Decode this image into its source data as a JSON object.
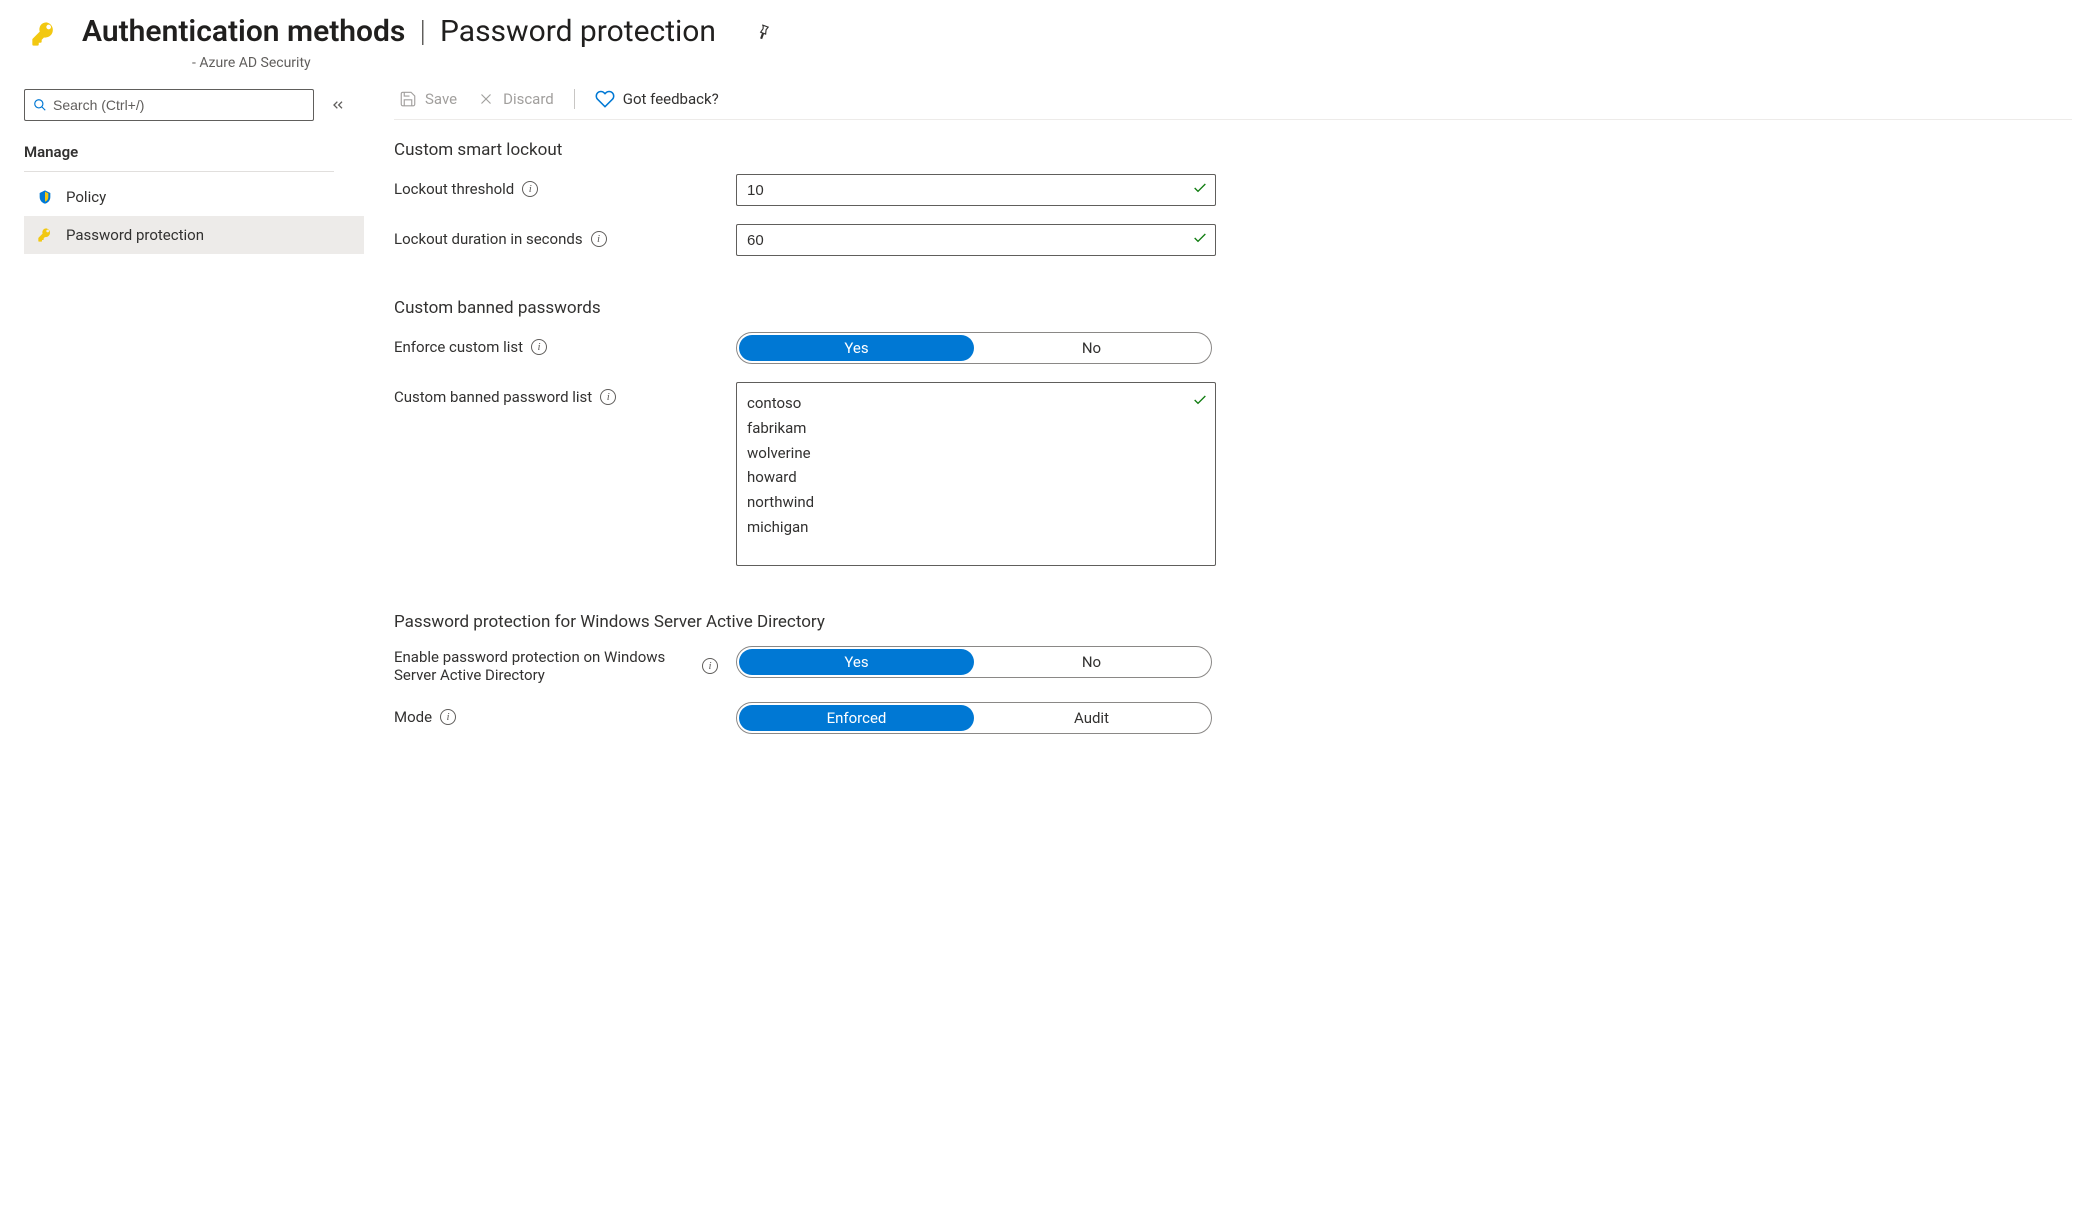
{
  "header": {
    "title_bold": "Authentication methods",
    "title_light": "Password protection",
    "subtitle": "- Azure AD Security"
  },
  "sidebar": {
    "search_placeholder": "Search (Ctrl+/)",
    "section_label": "Manage",
    "items": [
      {
        "label": "Policy"
      },
      {
        "label": "Password protection"
      }
    ]
  },
  "toolbar": {
    "save": "Save",
    "discard": "Discard",
    "feedback": "Got feedback?"
  },
  "form": {
    "section_lockout": "Custom smart lockout",
    "lockout_threshold_label": "Lockout threshold",
    "lockout_threshold_value": "10",
    "lockout_duration_label": "Lockout duration in seconds",
    "lockout_duration_value": "60",
    "section_banned": "Custom banned passwords",
    "enforce_custom_label": "Enforce custom list",
    "enforce_custom": {
      "yes": "Yes",
      "no": "No",
      "selected": "yes"
    },
    "banned_list_label": "Custom banned password list",
    "banned_list_value": "contoso\nfabrikam\nwolverine\nhoward\nnorthwind\nmichigan",
    "section_winserver": "Password protection for Windows Server Active Directory",
    "enable_winserver_label": "Enable password protection on Windows Server Active Directory",
    "enable_winserver": {
      "yes": "Yes",
      "no": "No",
      "selected": "yes"
    },
    "mode_label": "Mode",
    "mode": {
      "enforced": "Enforced",
      "audit": "Audit",
      "selected": "enforced"
    }
  }
}
